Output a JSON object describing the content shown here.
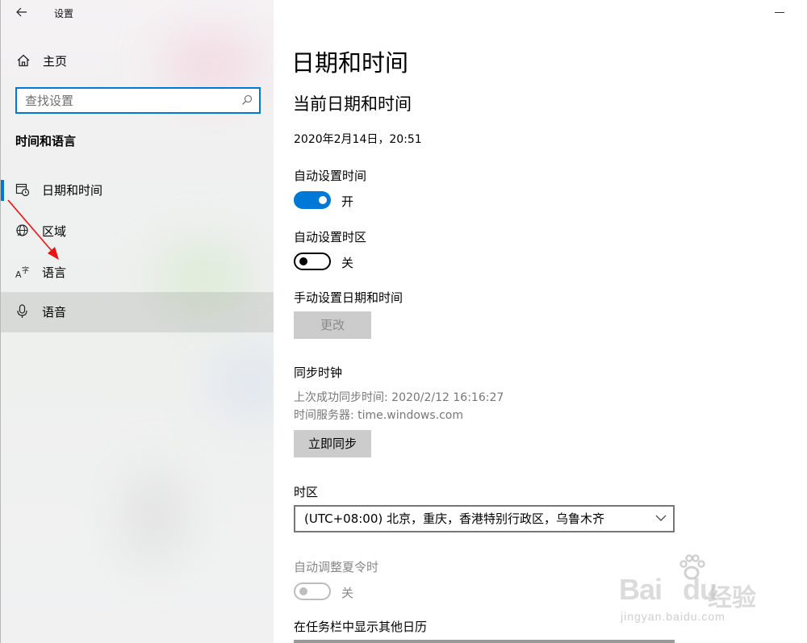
{
  "app": {
    "title": "设置"
  },
  "sidebar": {
    "home_label": "主页",
    "search_placeholder": "查找设置",
    "section_title": "时间和语言",
    "items": [
      {
        "label": "日期和时间",
        "icon": "calendar-clock-icon",
        "active": true
      },
      {
        "label": "区域",
        "icon": "globe-icon"
      },
      {
        "label": "语言",
        "icon": "language-icon"
      },
      {
        "label": "语音",
        "icon": "microphone-icon",
        "hover": true
      }
    ]
  },
  "main": {
    "title": "日期和时间",
    "current_heading": "当前日期和时间",
    "current_value": "2020年2月14日，20:51",
    "auto_time_label": "自动设置时间",
    "auto_time_state": "开",
    "auto_zone_label": "自动设置时区",
    "auto_zone_state": "关",
    "manual_label": "手动设置日期和时间",
    "change_button": "更改",
    "sync_heading": "同步时钟",
    "sync_last": "上次成功同步时间: 2020/2/12 16:16:27",
    "sync_server": "时间服务器: time.windows.com",
    "sync_button": "立即同步",
    "timezone_label": "时区",
    "timezone_value": "(UTC+08:00) 北京，重庆，香港特别行政区，乌鲁木齐",
    "dst_label": "自动调整夏令时",
    "dst_state": "关",
    "calendar_label": "在任务栏中显示其他日历"
  },
  "watermark": {
    "brand": "Bai",
    "brand2": "du",
    "cn": "经验",
    "url": "jingyan.baidu.com"
  },
  "colors": {
    "accent": "#0078d7"
  }
}
